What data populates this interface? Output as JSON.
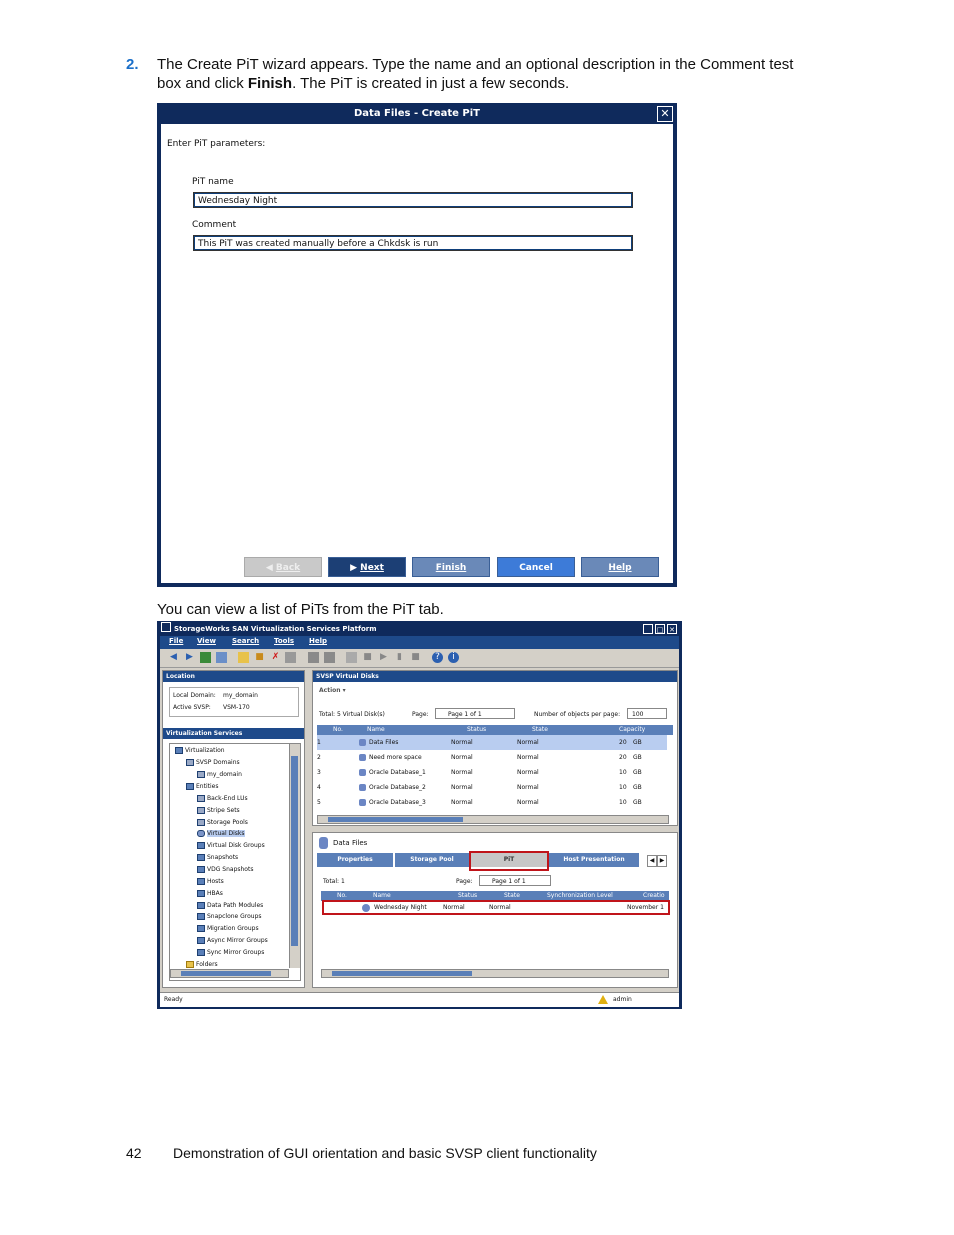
{
  "step": {
    "number": "2.",
    "line1": "The Create PiT wizard appears. Type the name and an optional description in the Comment test",
    "line2_pre": "box and click ",
    "line2_bold": "Finish",
    "line2_post": ". The PiT is created in just a few seconds."
  },
  "wizard": {
    "title": "Data Files - Create PiT",
    "close_glyph": "✕",
    "heading": "Enter PiT parameters:",
    "pit_name_label": "PiT name",
    "pit_name_value": "Wednesday Night",
    "comment_label": "Comment",
    "comment_value": "This PiT was created manually before a Chkdsk is run",
    "buttons": {
      "back": "Back",
      "next": "Next",
      "finish": "Finish",
      "cancel": "Cancel",
      "help": "Help"
    }
  },
  "caption": "You can view a list of PiTs from the PiT tab.",
  "app": {
    "title": "StorageWorks SAN Virtualization Services Platform",
    "menus": [
      "File",
      "View",
      "Search",
      "Tools",
      "Help"
    ],
    "location": {
      "header": "Location",
      "local_domain_label": "Local Domain:",
      "local_domain_value": "my_domain",
      "active_svsp_label": "Active SVSP:",
      "active_svsp_value": "VSM-170"
    },
    "virt_services_header": "Virtualization Services",
    "tree": [
      "Virtualization",
      "SVSP Domains",
      "my_domain",
      "Entities",
      "Back-End LUs",
      "Stripe Sets",
      "Storage Pools",
      "Virtual Disks",
      "Virtual Disk Groups",
      "Snapshots",
      "VDG Snapshots",
      "Hosts",
      "HBAs",
      "Data Path Modules",
      "Snapclone Groups",
      "Migration Groups",
      "Async Mirror Groups",
      "Sync Mirror Groups",
      "Folders"
    ],
    "vdisks": {
      "header": "SVSP Virtual Disks",
      "action": "Action ▾",
      "total": "Total: 5 Virtual Disk(s)",
      "page_label": "Page:",
      "page_value": "Page 1 of 1",
      "objects_label": "Number of objects per page:",
      "objects_value": "100",
      "columns": [
        "No.",
        "Name",
        "Status",
        "State",
        "Capacity"
      ],
      "rows": [
        [
          "1",
          "Data Files",
          "Normal",
          "Normal",
          "20",
          "GB"
        ],
        [
          "2",
          "Need more space",
          "Normal",
          "Normal",
          "20",
          "GB"
        ],
        [
          "3",
          "Oracle Database_1",
          "Normal",
          "Normal",
          "10",
          "GB"
        ],
        [
          "4",
          "Oracle Database_2",
          "Normal",
          "Normal",
          "10",
          "GB"
        ],
        [
          "5",
          "Oracle Database_3",
          "Normal",
          "Normal",
          "10",
          "GB"
        ]
      ]
    },
    "detail": {
      "title": "Data Files",
      "tabs": [
        "Properties",
        "Storage Pool",
        "PiT",
        "Host Presentation"
      ],
      "total": "Total: 1",
      "page_label": "Page:",
      "page_value": "Page 1 of 1",
      "columns": [
        "No.",
        "Name",
        "Status",
        "State",
        "Synchronization Level",
        "Creatio"
      ],
      "row": [
        "1",
        "Wednesday Night",
        "Normal",
        "Normal",
        "",
        "November 1"
      ]
    },
    "status": {
      "left": "Ready",
      "user": "admin"
    }
  },
  "footer": {
    "page_number": "42",
    "text": "Demonstration of GUI orientation and basic SVSP client functionality"
  }
}
